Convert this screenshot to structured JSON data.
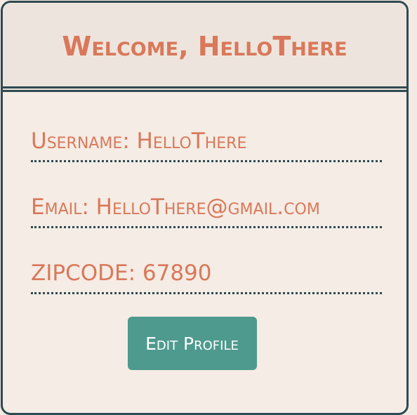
{
  "header": {
    "title": "Welcome, HelloThere"
  },
  "profile": {
    "username": "Username: HelloThere",
    "email": "Email: HelloThere@gmail.com",
    "zipcode": "ZIPCODE: 67890"
  },
  "actions": {
    "edit_label": "Edit Profile"
  },
  "colors": {
    "accent": "#d9785a",
    "border": "#2f4a52",
    "button": "#4e9a8e",
    "background": "#f4ece5",
    "header_bg": "#ede5dd"
  }
}
